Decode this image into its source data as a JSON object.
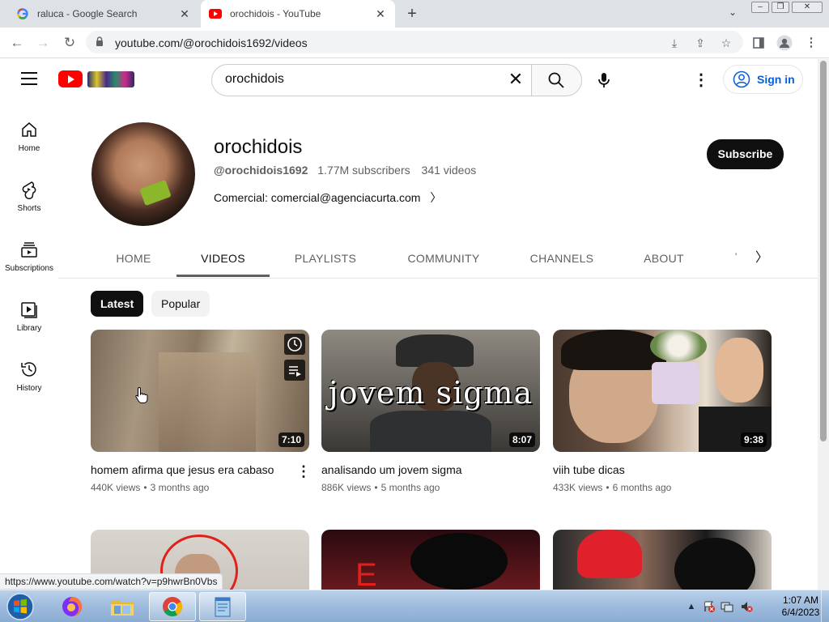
{
  "browser": {
    "tabs": [
      {
        "title": "raluca - Google Search",
        "favicon": "google-icon",
        "active": false
      },
      {
        "title": "orochidois - YouTube",
        "favicon": "youtube-icon",
        "active": true
      }
    ],
    "url": "youtube.com/@orochidois1692/videos",
    "status_url": "https://www.youtube.com/watch?v=p9hwrBn0Vbs"
  },
  "header": {
    "search_value": "orochidois",
    "search_placeholder": "Search",
    "signin_label": "Sign in"
  },
  "guide": [
    {
      "label": "Home",
      "icon": "home-icon"
    },
    {
      "label": "Shorts",
      "icon": "shorts-icon"
    },
    {
      "label": "Subscriptions",
      "icon": "subscriptions-icon"
    },
    {
      "label": "Library",
      "icon": "library-icon"
    },
    {
      "label": "History",
      "icon": "history-icon"
    }
  ],
  "channel": {
    "name": "orochidois",
    "handle": "@orochidois1692",
    "subscribers": "1.77M subscribers",
    "videos_count": "341 videos",
    "link_text": "Comercial: comercial@agenciacurta.com",
    "subscribe_label": "Subscribe"
  },
  "channel_tabs": [
    "HOME",
    "VIDEOS",
    "PLAYLISTS",
    "COMMUNITY",
    "CHANNELS",
    "ABOUT"
  ],
  "active_tab": "VIDEOS",
  "filters": {
    "latest": "Latest",
    "popular": "Popular",
    "selected": "Latest"
  },
  "videos": [
    {
      "title": "homem afirma que jesus era cabaso",
      "duration": "7:10",
      "views": "440K views",
      "age": "3 months ago"
    },
    {
      "title": "analisando um jovem sigma",
      "duration": "8:07",
      "views": "886K views",
      "age": "5 months ago",
      "thumb_text": "jovem sigma"
    },
    {
      "title": "viih tube dicas",
      "duration": "9:38",
      "views": "433K views",
      "age": "6 months ago"
    }
  ],
  "taskbar": {
    "clock_time": "1:07 AM",
    "clock_date": "6/4/2023",
    "apps": [
      "firefox-icon",
      "file-explorer-icon",
      "chrome-icon",
      "notepad-icon"
    ]
  },
  "colors": {
    "yt_red": "#ff0000",
    "link_blue": "#065fd4",
    "subscribe_bg": "#0f0f0f",
    "taskbar": "#9ebbdd"
  }
}
